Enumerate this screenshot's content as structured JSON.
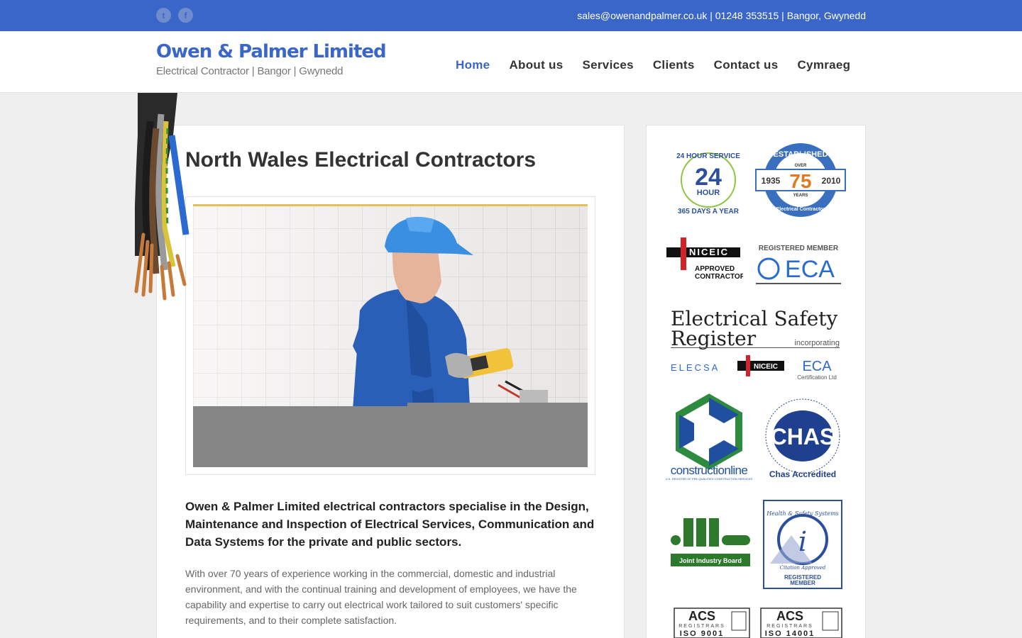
{
  "topbar": {
    "contact": "sales@owenandpalmer.co.uk | 01248 353515 | Bangor, Gwynedd",
    "social": [
      {
        "icon": "twitter-icon",
        "glyph": "t"
      },
      {
        "icon": "facebook-icon",
        "glyph": "f"
      }
    ]
  },
  "logo": {
    "title": "Owen & Palmer Limited",
    "subtitle": "Electrical Contractor | Bangor | Gwynedd"
  },
  "nav": [
    {
      "label": "Home",
      "active": true
    },
    {
      "label": "About us",
      "active": false
    },
    {
      "label": "Services",
      "active": false
    },
    {
      "label": "Clients",
      "active": false
    },
    {
      "label": "Contact us",
      "active": false
    },
    {
      "label": "Cymraeg",
      "active": false
    }
  ],
  "main": {
    "title": "North Wales Electrical Contractors",
    "lead": "Owen & Palmer Limited electrical contractors specialise in the Design, Maintenance and Inspection of Electrical Services, Communication and Data Systems for the private and public sectors.",
    "body": "With over 70 years of experience working in the commercial, domestic and industrial environment, and with the continual training and development of employees, we have the capability and expertise to carry out electrical work tailored to suit customers' specific requirements, and to their complete satisfaction."
  },
  "badges": {
    "service24": {
      "top": "24 HOUR SERVICE",
      "num": "24",
      "hour": "HOUR",
      "bottom": "365 DAYS A YEAR"
    },
    "established": {
      "top": "ESTABLISHED",
      "over": "OVER",
      "num": "75",
      "years": "YEARS",
      "from": "1935",
      "to": "2010",
      "bottom": "Electrical Contractor"
    },
    "niceic": {
      "logo": "NICEIC",
      "line1": "APPROVED",
      "line2": "CONTRACTOR"
    },
    "eca": {
      "label": "REGISTERED MEMBER",
      "logo": "ECA"
    },
    "esr": {
      "line1": "Electrical Safety",
      "line2": "Register",
      "incorporating": "incorporating",
      "elecsa": "ELECSA",
      "niceic": "NICEIC",
      "eca": "ECA",
      "eca_sub": "Certification Ltd"
    },
    "constructionline": {
      "name": "constructionline",
      "sub": "U.K. REGISTER OF PRE-QUALIFIED CONSTRUCTION SERVICES"
    },
    "chas": {
      "logo": "CHAS",
      "ring": "HEALTH & SAFETY ASSESSMENT SCHEME · CONTRACTORS",
      "label": "Chas Accredited"
    },
    "jib": {
      "label": "Joint Industry Board"
    },
    "citation": {
      "ring": "Health & Safety Systems",
      "approved": "Citation Approved",
      "label1": "REGISTERED",
      "label2": "MEMBER"
    },
    "acs1": {
      "logo": "ACS",
      "reg": "REGISTRARS",
      "std": "ISO 9001"
    },
    "acs2": {
      "logo": "ACS",
      "reg": "REGISTRARS",
      "std": "ISO 14001"
    }
  },
  "colors": {
    "brand": "#3a66c9",
    "text": "#333333",
    "muted": "#666666",
    "orange": "#e07a22",
    "red": "#d3232a",
    "green": "#3f8f3f"
  }
}
